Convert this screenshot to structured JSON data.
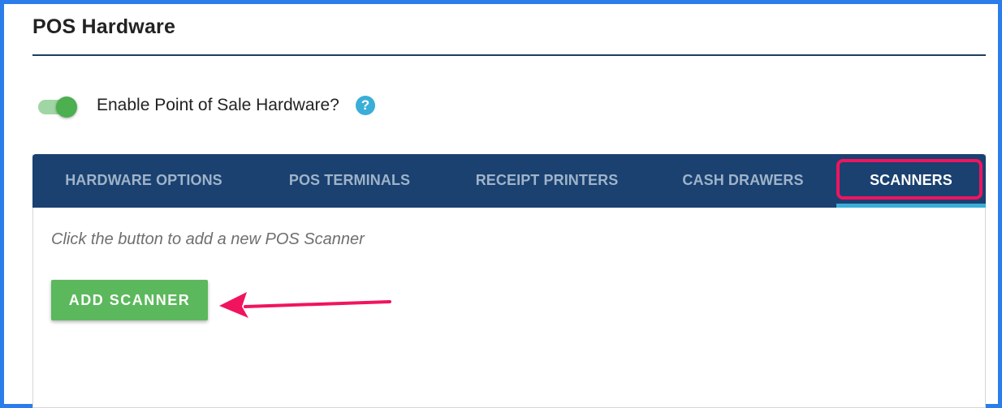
{
  "page": {
    "title": "POS Hardware"
  },
  "toggle": {
    "label": "Enable Point of Sale Hardware?",
    "enabled": true,
    "help_icon": "question-mark-icon"
  },
  "tabs": [
    {
      "label": "HARDWARE OPTIONS",
      "active": false
    },
    {
      "label": "POS TERMINALS",
      "active": false
    },
    {
      "label": "RECEIPT PRINTERS",
      "active": false
    },
    {
      "label": "CASH DRAWERS",
      "active": false
    },
    {
      "label": "SCANNERS",
      "active": true
    }
  ],
  "scanners": {
    "hint": "Click the button to add a new POS Scanner",
    "add_button_label": "ADD SCANNER"
  },
  "annotations": {
    "highlight_color": "#f0145f",
    "arrow_color": "#f0145f"
  },
  "colors": {
    "tabbar": "#1a4170",
    "accent_green": "#5cb85c",
    "tab_underline": "#3aaed8"
  }
}
